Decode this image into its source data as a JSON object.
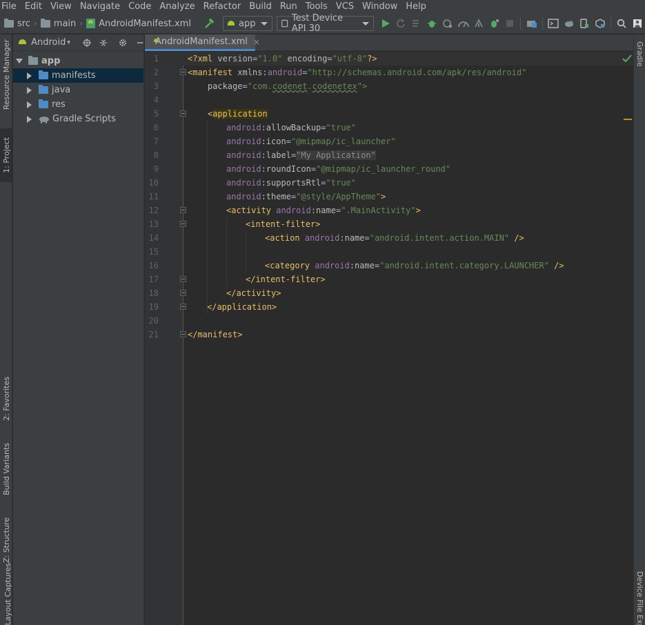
{
  "menu": [
    "File",
    "Edit",
    "View",
    "Navigate",
    "Code",
    "Analyze",
    "Refactor",
    "Build",
    "Run",
    "Tools",
    "VCS",
    "Window",
    "Help"
  ],
  "breadcrumb": [
    "src",
    "main",
    "AndroidManifest.xml"
  ],
  "toolbar": {
    "run_config": "app",
    "device": "Test Device API 30"
  },
  "left_tabs": [
    "Resource Manager",
    "1: Project",
    "2: Favorites",
    "Build Variants",
    "Z: Structure",
    "Layout Captures"
  ],
  "right_tabs": [
    "Gradle",
    "Device File Explorer"
  ],
  "project": {
    "view_mode": "Android",
    "tree": [
      {
        "label": "app",
        "level": 0,
        "expanded": true
      },
      {
        "label": "manifests",
        "level": 1,
        "selected": true
      },
      {
        "label": "java",
        "level": 1
      },
      {
        "label": "res",
        "level": 1
      },
      {
        "label": "Gradle Scripts",
        "level": 0
      }
    ]
  },
  "editor": {
    "tab_label": "AndroidManifest.xml",
    "tab_close": "×",
    "line_numbers": [
      "1",
      "2",
      "3",
      "4",
      "5",
      "6",
      "7",
      "8",
      "9",
      "10",
      "11",
      "12",
      "13",
      "14",
      "15",
      "16",
      "17",
      "18",
      "19",
      "20",
      "21"
    ],
    "lines": {
      "l1": {
        "a": "<?xml ",
        "b": "version",
        "c": "=",
        "d": "\"1.0\"",
        "e": " encoding",
        "f": "=",
        "g": "\"utf-8\"",
        "h": "?>"
      },
      "l2": {
        "a": "<manifest ",
        "b": "xmlns:",
        "c": "android",
        "d": "=",
        "e": "\"http://schemas.android.com/apk/res/android\""
      },
      "l3": {
        "a": "    package",
        "b": "=",
        "c": "\"com.",
        "d": "codenet",
        "e": ".",
        "f": "codenetex",
        "g": "\">"
      },
      "l5": {
        "a": "    <",
        "b": "application"
      },
      "l6": {
        "a": "android",
        "b": ":allowBackup",
        "c": "=",
        "d": "\"true\""
      },
      "l7": {
        "a": "android",
        "b": ":icon",
        "c": "=",
        "d": "\"@mipmap/ic_launcher\""
      },
      "l8": {
        "a": "android",
        "b": ":label",
        "c": "=",
        "d": "\"My Application\""
      },
      "l9": {
        "a": "android",
        "b": ":roundIcon",
        "c": "=",
        "d": "\"@mipmap/ic_launcher_round\""
      },
      "l10": {
        "a": "android",
        "b": ":supportsRtl",
        "c": "=",
        "d": "\"true\""
      },
      "l11": {
        "a": "android",
        "b": ":theme",
        "c": "=",
        "d": "\"@style/AppTheme\"",
        "e": ">"
      },
      "l12": {
        "a": "<activity ",
        "b": "android",
        "c": ":name",
        "d": "=",
        "e": "\".MainActivity\"",
        "f": ">"
      },
      "l13": {
        "a": "<intent-filter>"
      },
      "l14": {
        "a": "<action ",
        "b": "android",
        "c": ":name",
        "d": "=",
        "e": "\"android.intent.action.MAIN\"",
        "f": " />"
      },
      "l16": {
        "a": "<category ",
        "b": "android",
        "c": ":name",
        "d": "=",
        "e": "\"android.intent.category.LAUNCHER\"",
        "f": " />"
      },
      "l17": {
        "a": "</intent-filter>"
      },
      "l18": {
        "a": "</activity>"
      },
      "l19": {
        "a": "</application>"
      },
      "l21": {
        "a": "</manifest>"
      }
    }
  }
}
